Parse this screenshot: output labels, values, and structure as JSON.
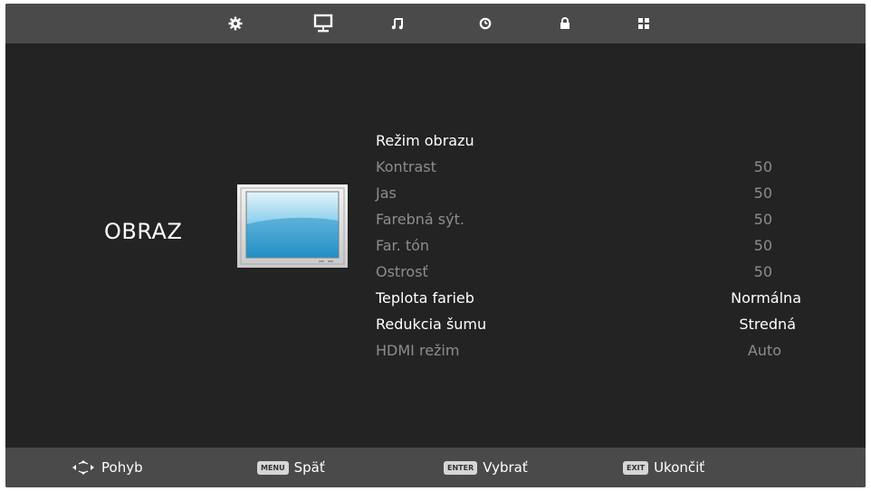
{
  "tabs": [
    {
      "icon": "gear-icon"
    },
    {
      "icon": "monitor-icon"
    },
    {
      "icon": "music-note-icon"
    },
    {
      "icon": "clock-icon"
    },
    {
      "icon": "lock-icon"
    },
    {
      "icon": "grid-icon"
    }
  ],
  "page_title": "OBRAZ",
  "menu": {
    "header": "Režim obrazu",
    "items": [
      {
        "label": "Kontrast",
        "value": "50",
        "enabled": false
      },
      {
        "label": "Jas",
        "value": "50",
        "enabled": false
      },
      {
        "label": "Farebná sýt.",
        "value": "50",
        "enabled": false
      },
      {
        "label": "Far. tón",
        "value": "50",
        "enabled": false
      },
      {
        "label": "Ostrosť",
        "value": "50",
        "enabled": false
      },
      {
        "label": "Teplota farieb",
        "value": "Normálna",
        "enabled": true
      },
      {
        "label": "Redukcia šumu",
        "value": "Stredná",
        "enabled": true
      },
      {
        "label": "HDMI režim",
        "value": "Auto",
        "enabled": false
      }
    ]
  },
  "footer": {
    "move_label": "Pohyb",
    "menu_key": "MENU",
    "back_label": "Späť",
    "enter_key": "ENTER",
    "select_label": "Vybrať",
    "exit_key": "EXIT",
    "exit_label": "Ukončiť"
  },
  "colors": {
    "background": "#232323",
    "bars": "#4a4a4a",
    "active_text": "#ffffff",
    "disabled_text": "#8d8d8d"
  }
}
